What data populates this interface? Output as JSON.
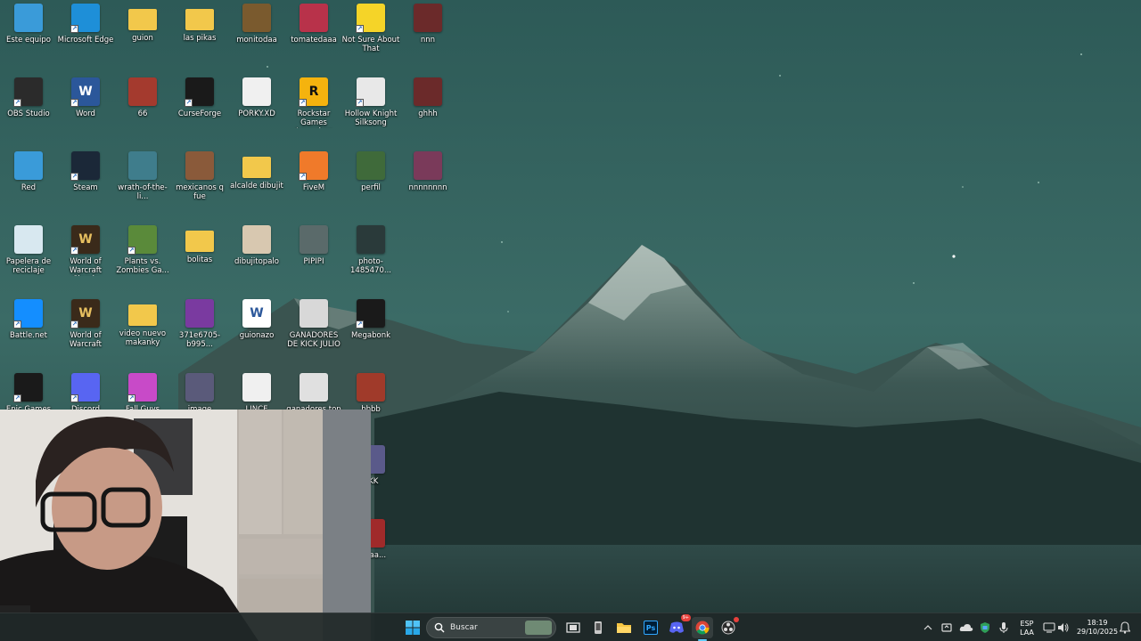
{
  "desktop": {
    "icons": [
      {
        "label": "Este equipo",
        "icon": "computer-icon",
        "color": "#3a9bd9",
        "glyph": "",
        "shortcut": false
      },
      {
        "label": "Microsoft Edge",
        "icon": "edge-icon",
        "color": "#1e8fd8",
        "glyph": "",
        "shortcut": true
      },
      {
        "label": "guion",
        "icon": "folder-icon",
        "color": "#f2c84b",
        "glyph": "",
        "shortcut": false
      },
      {
        "label": "las pikas",
        "icon": "folder-icon",
        "color": "#f2c84b",
        "glyph": "",
        "shortcut": false
      },
      {
        "label": "monitodaa",
        "icon": "image-file-icon",
        "color": "#7a5a2e",
        "glyph": "",
        "shortcut": false
      },
      {
        "label": "tomatedaaa",
        "icon": "image-file-icon",
        "color": "#b8324a",
        "glyph": "",
        "shortcut": false
      },
      {
        "label": "Not Sure About That",
        "icon": "duck-icon",
        "color": "#f5d428",
        "glyph": "",
        "shortcut": true
      },
      {
        "label": "nnn",
        "icon": "image-file-icon",
        "color": "#6b2a2a",
        "glyph": "",
        "shortcut": false
      },
      {
        "label": "OBS Studio",
        "icon": "obs-icon",
        "color": "#2b2b2b",
        "glyph": "",
        "shortcut": true
      },
      {
        "label": "Word",
        "icon": "word-icon",
        "color": "#2b579a",
        "glyph": "W",
        "shortcut": true
      },
      {
        "label": "66",
        "icon": "image-file-icon",
        "color": "#a43a2e",
        "glyph": "",
        "shortcut": false
      },
      {
        "label": "CurseForge",
        "icon": "curseforge-icon",
        "color": "#1a1a1a",
        "glyph": "",
        "shortcut": true
      },
      {
        "label": "PORKY.XD",
        "icon": "video-file-icon",
        "color": "#f0f0f0",
        "glyph": "",
        "shortcut": false
      },
      {
        "label": "Rockstar Games Launcher",
        "icon": "rockstar-icon",
        "color": "#f5b30e",
        "glyph": "R",
        "shortcut": true
      },
      {
        "label": "Hollow Knight Silksong",
        "icon": "hollow-knight-icon",
        "color": "#e8e8e8",
        "glyph": "",
        "shortcut": true
      },
      {
        "label": "ghhh",
        "icon": "image-file-icon",
        "color": "#6b2a2a",
        "glyph": "",
        "shortcut": false
      },
      {
        "label": "Red",
        "icon": "network-icon",
        "color": "#3a9bd9",
        "glyph": "",
        "shortcut": false
      },
      {
        "label": "Steam",
        "icon": "steam-icon",
        "color": "#1b2838",
        "glyph": "",
        "shortcut": true
      },
      {
        "label": "wrath-of-the-li...",
        "icon": "image-file-icon",
        "color": "#3f7d8c",
        "glyph": "",
        "shortcut": false
      },
      {
        "label": "mexicanos q fue",
        "icon": "image-file-icon",
        "color": "#8a5a3a",
        "glyph": "",
        "shortcut": false
      },
      {
        "label": "alcalde dibujit",
        "icon": "folder-icon",
        "color": "#f2c84b",
        "glyph": "",
        "shortcut": false
      },
      {
        "label": "FiveM",
        "icon": "fivem-icon",
        "color": "#f07a2a",
        "glyph": "",
        "shortcut": true
      },
      {
        "label": "perfil",
        "icon": "image-file-icon",
        "color": "#3f6a3a",
        "glyph": "",
        "shortcut": false
      },
      {
        "label": "nnnnnnnn",
        "icon": "image-file-icon",
        "color": "#7a3a5a",
        "glyph": "",
        "shortcut": false
      },
      {
        "label": "Papelera de reciclaje",
        "icon": "recycle-bin-icon",
        "color": "#d8e8f0",
        "glyph": "",
        "shortcut": false
      },
      {
        "label": "World of Warcraft Classic",
        "icon": "wow-icon",
        "color": "#3a2a1a",
        "glyph": "W",
        "shortcut": true
      },
      {
        "label": "Plants vs. Zombies Ga...",
        "icon": "pvz-icon",
        "color": "#5a8a3a",
        "glyph": "",
        "shortcut": true
      },
      {
        "label": "bolitas",
        "icon": "folder-icon",
        "color": "#f2c84b",
        "glyph": "",
        "shortcut": false
      },
      {
        "label": "dibujitopalo",
        "icon": "image-file-icon",
        "color": "#d8c8b0",
        "glyph": "",
        "shortcut": false
      },
      {
        "label": "PIPIPI",
        "icon": "image-file-icon",
        "color": "#5a6a6a",
        "glyph": "",
        "shortcut": false
      },
      {
        "label": "photo-1485470...",
        "icon": "image-file-icon",
        "color": "#2a3a3a",
        "glyph": "",
        "shortcut": false
      },
      {
        "label": "Battle.net",
        "icon": "battlenet-icon",
        "color": "#148eff",
        "glyph": "",
        "shortcut": true
      },
      {
        "label": "World of Warcraft",
        "icon": "wow-icon",
        "color": "#3a2a1a",
        "glyph": "W",
        "shortcut": true
      },
      {
        "label": "video nuevo makanky",
        "icon": "folder-icon",
        "color": "#f2c84b",
        "glyph": "",
        "shortcut": false
      },
      {
        "label": "371e6705-b995...",
        "icon": "file-icon",
        "color": "#7a3aa0",
        "glyph": "",
        "shortcut": false
      },
      {
        "label": "guionazo",
        "icon": "word-doc-icon",
        "color": "#ffffff",
        "glyph": "W",
        "shortcut": false
      },
      {
        "label": "GANADORES DE KICK JULIO",
        "icon": "image-file-icon",
        "color": "#d8d8d8",
        "glyph": "",
        "shortcut": false
      },
      {
        "label": "Megabonk",
        "icon": "megabonk-icon",
        "color": "#1a1a1a",
        "glyph": "",
        "shortcut": true
      },
      {
        "label": "Epic Games",
        "icon": "epic-games-icon",
        "color": "#1a1a1a",
        "glyph": "",
        "shortcut": true
      },
      {
        "label": "Discord",
        "icon": "discord-icon",
        "color": "#5865f2",
        "glyph": "",
        "shortcut": true
      },
      {
        "label": "Fall Guys",
        "icon": "fall-guys-icon",
        "color": "#c84ac8",
        "glyph": "",
        "shortcut": true
      },
      {
        "label": "image",
        "icon": "image-file-icon",
        "color": "#5a5a7a",
        "glyph": "",
        "shortcut": false
      },
      {
        "label": "LINCE",
        "icon": "video-file-icon",
        "color": "#f0f0f0",
        "glyph": "",
        "shortcut": false
      },
      {
        "label": "ganadores top",
        "icon": "image-file-icon",
        "color": "#e0e0e0",
        "glyph": "",
        "shortcut": false
      },
      {
        "label": "bbbb",
        "icon": "image-file-icon",
        "color": "#a03a2a",
        "glyph": "",
        "shortcut": false
      },
      {
        "label": "KKK",
        "icon": "image-file-icon",
        "color": "#5a5a8a",
        "glyph": "",
        "shortcut": false
      },
      {
        "label": "aaaaa...",
        "icon": "image-file-icon",
        "color": "#a02a2a",
        "glyph": "",
        "shortcut": false
      }
    ]
  },
  "taskbar": {
    "search_label": "Buscar",
    "language_line1": "ESP",
    "language_line2": "LAA",
    "time": "18:19",
    "date": "29/10/2025",
    "discord_badge": "9+",
    "apps": [
      {
        "name": "start-button",
        "icon": "windows-icon"
      },
      {
        "name": "task-view-button",
        "icon": "task-view-icon"
      },
      {
        "name": "taskbar-app-widget",
        "icon": "phone-icon"
      },
      {
        "name": "taskbar-app-explorer",
        "icon": "folder-icon"
      },
      {
        "name": "taskbar-app-photoshop",
        "icon": "photoshop-icon"
      },
      {
        "name": "taskbar-app-discord",
        "icon": "discord-icon"
      },
      {
        "name": "taskbar-app-chrome",
        "icon": "chrome-icon"
      },
      {
        "name": "taskbar-app-obs",
        "icon": "obs-icon"
      }
    ]
  }
}
